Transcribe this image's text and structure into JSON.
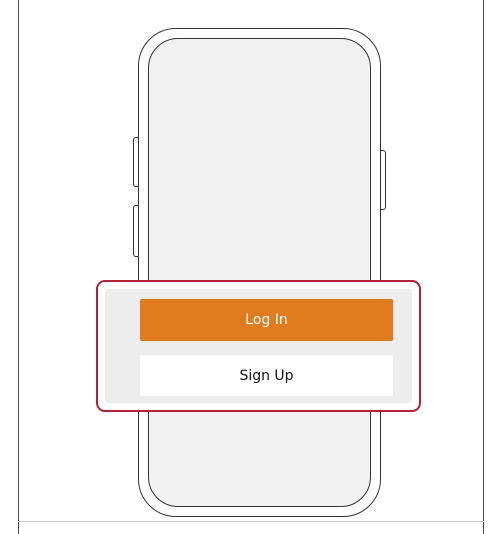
{
  "auth": {
    "login_label": "Log In",
    "signup_label": "Sign Up"
  },
  "colors": {
    "login_button": "#e07b20",
    "highlight_border": "#b32239",
    "phone_screen": "#f1f1f1"
  }
}
